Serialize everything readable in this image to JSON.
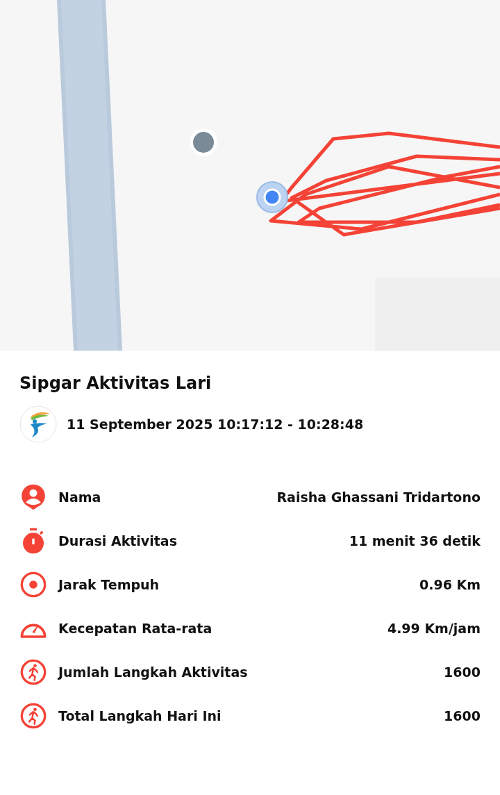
{
  "title": "Sipgar Aktivitas Lari",
  "date_range": "11 September 2025 10:17:12 - 10:28:48",
  "stats": [
    {
      "kind": "person",
      "label": "Nama",
      "value": "Raisha Ghassani Tridartono"
    },
    {
      "kind": "timer",
      "label": "Durasi Aktivitas",
      "value": "11 menit 36 detik"
    },
    {
      "kind": "distance",
      "label": "Jarak Tempuh",
      "value": "0.96 Km"
    },
    {
      "kind": "speed",
      "label": "Kecepatan Rata-rata",
      "value": "4.99 Km/jam"
    },
    {
      "kind": "steps",
      "label": "Jumlah Langkah Aktivitas",
      "value": "1600"
    },
    {
      "kind": "steps",
      "label": "Total Langkah Hari Ini",
      "value": "1600"
    }
  ]
}
